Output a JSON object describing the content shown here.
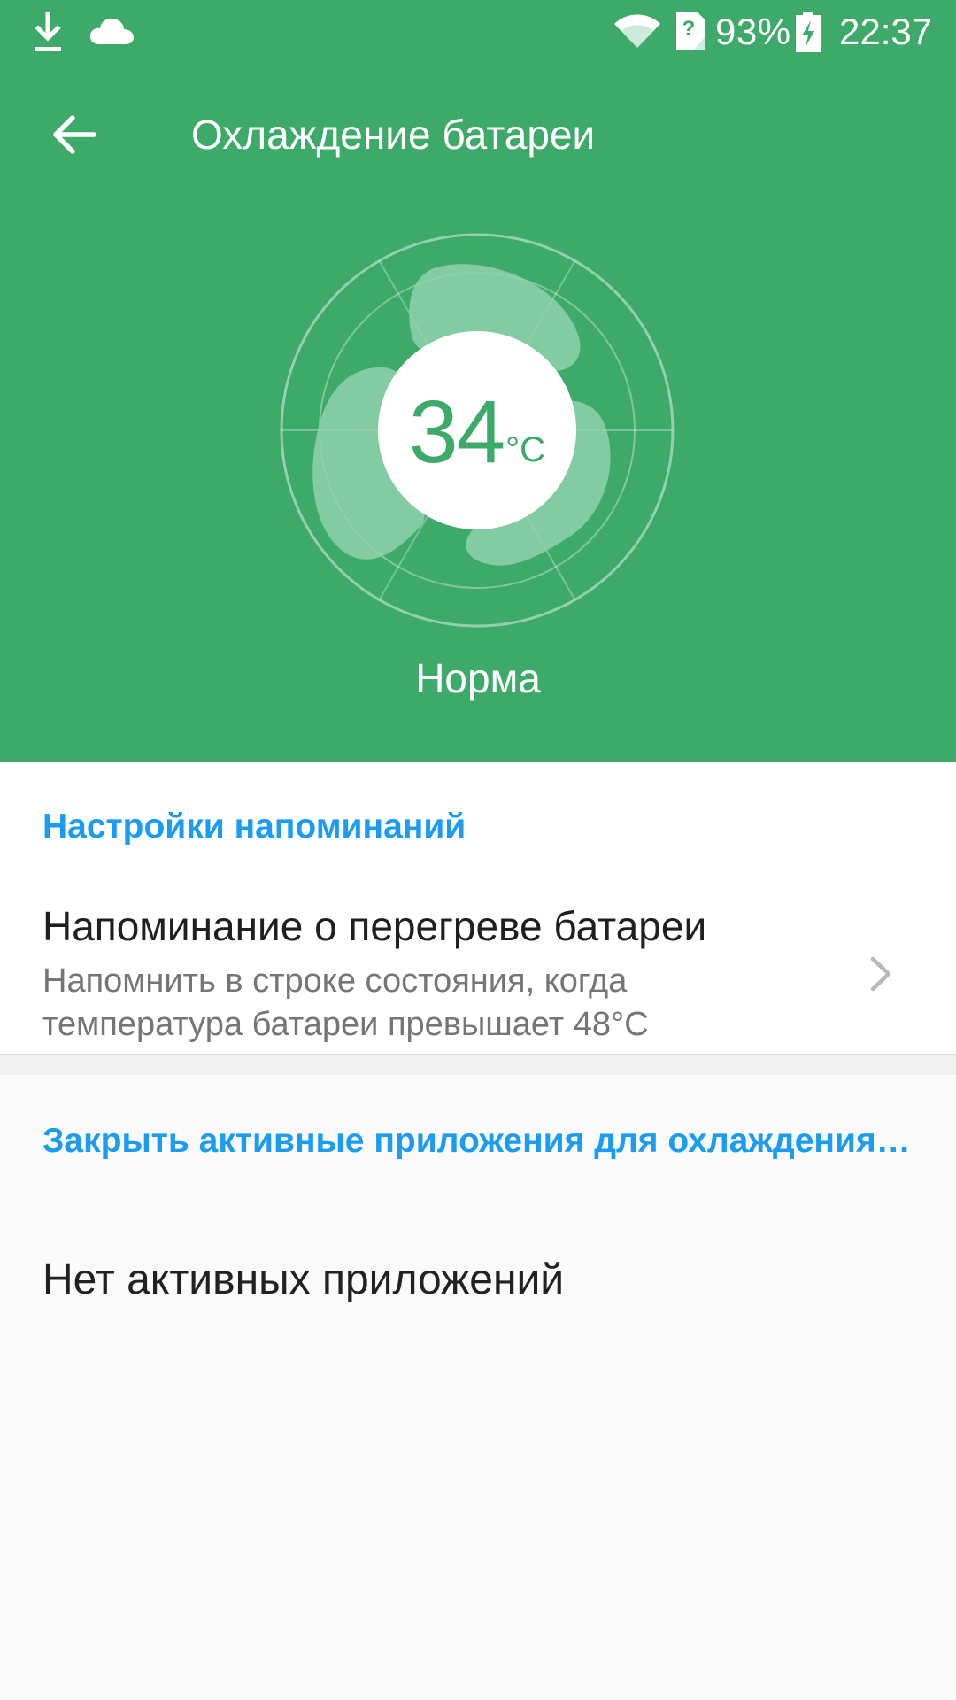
{
  "status_bar": {
    "icons": {
      "download": "download-arrow-icon",
      "cloud": "cloud-icon",
      "wifi": "wifi-icon",
      "sim": "no-sim-icon",
      "battery": "battery-charging-icon"
    },
    "sim_symbol": "?",
    "battery_percent": "93%",
    "time": "22:37"
  },
  "toolbar": {
    "back_icon": "arrow-back-icon",
    "title": "Охлаждение батареи"
  },
  "gauge": {
    "icon": "fan-icon",
    "temperature": "34",
    "unit": "°C",
    "status": "Норма"
  },
  "reminder_section": {
    "header": "Настройки напоминаний",
    "item": {
      "title": "Напоминание о перегреве батареи",
      "subtitle": "Напомнить в строке состояния, когда температура батареи превышает 48°C",
      "chevron_icon": "chevron-right-icon"
    }
  },
  "apps_section": {
    "header": "Закрыть активные приложения для охлаждения…",
    "empty_text": "Нет активных приложений"
  },
  "colors": {
    "header_green": "#3daa6a",
    "accent_blue": "#1b9cf0",
    "background": "#fafafa",
    "fan_blade": "#7fcaa0"
  }
}
